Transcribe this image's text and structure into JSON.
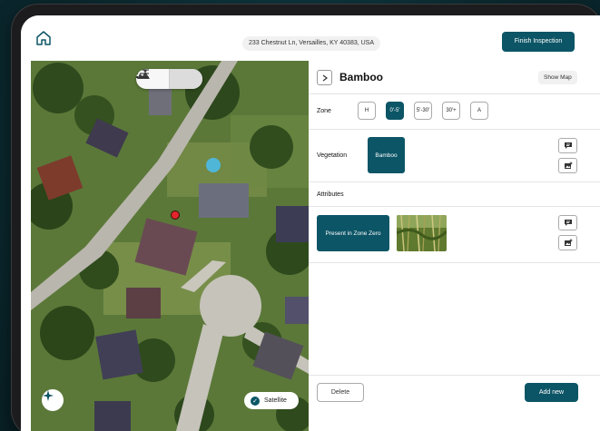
{
  "header": {
    "address": "233 Chestnut Ln, Versailles, KY 40383, USA",
    "finish_label": "Finish Inspection"
  },
  "map": {
    "satellite_label": "Satellite",
    "marker_color": "#e3262b"
  },
  "panel": {
    "title": "Bamboo",
    "show_map_label": "Show Map",
    "zone": {
      "label": "Zone",
      "options": [
        "H",
        "0'-5'",
        "5'-30'",
        "30'+",
        "A"
      ],
      "selected": "0'-5'"
    },
    "vegetation": {
      "label": "Vegetation",
      "value": "Bamboo"
    },
    "attributes": {
      "label": "Attributes",
      "value": "Present in Zone Zero"
    },
    "delete_label": "Delete",
    "add_label": "Add new"
  },
  "colors": {
    "accent": "#0c5566",
    "background": "#0b2b31"
  },
  "icons": [
    "home-icon",
    "map-view-icon",
    "list-view-icon",
    "chevron-right-icon",
    "comment-icon",
    "add-photo-icon",
    "sparkle-icon",
    "check-icon"
  ]
}
